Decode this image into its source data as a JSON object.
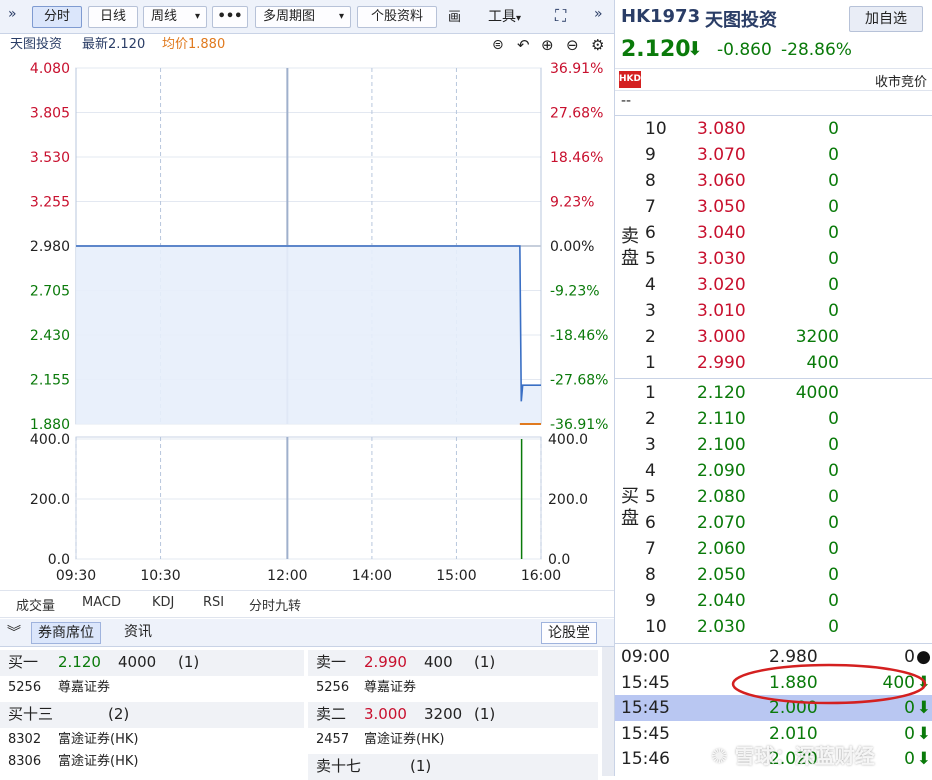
{
  "toolbar": {
    "expand_icon": "double-chevron-right-icon",
    "buttons": [
      "分时",
      "日线",
      "周线",
      "•••",
      "多周期图",
      "个股资料",
      "画",
      "工具"
    ],
    "fullscreen_icon": "fullscreen-icon",
    "collapse_icon": "double-chevron-right-icon"
  },
  "infobar": {
    "name": "天图投资",
    "latest": "最新2.120",
    "avg": "均价1.880"
  },
  "chart_data": {
    "type": "line",
    "price_ticks_left": [
      "4.080",
      "3.805",
      "3.530",
      "3.255",
      "2.980",
      "2.705",
      "2.430",
      "2.155",
      "1.880"
    ],
    "pct_ticks_right": [
      "36.91%",
      "27.68%",
      "18.46%",
      "9.23%",
      "0.00%",
      "-9.23%",
      "-18.46%",
      "-27.68%",
      "-36.91%"
    ],
    "ylim": [
      1.88,
      4.08
    ],
    "prev_close": 2.98,
    "time_labels": [
      "09:30",
      "10:30",
      "12:00",
      "14:00",
      "15:00",
      "16:00"
    ],
    "series": [
      {
        "values": [
          {
            "t": "09:30",
            "y": 2.98
          },
          {
            "t": "15:45",
            "y": 2.98
          },
          {
            "t": "15:46",
            "y": 2.02
          },
          {
            "t": "15:47",
            "y": 2.12
          },
          {
            "t": "16:00",
            "y": 2.12
          }
        ]
      },
      {
        "values": [
          {
            "t": "15:45",
            "y": 1.88
          },
          {
            "t": "16:00",
            "y": 1.88
          }
        ]
      }
    ],
    "volume_ticks_left": [
      "400.0",
      "200.0",
      "0.0"
    ],
    "volume_ticks_right": [
      "400.0",
      "200.0",
      "0.0"
    ],
    "volume_ylim": [
      0,
      400
    ],
    "volume_bars": [
      {
        "t": "15:45",
        "v": 400
      }
    ]
  },
  "indicator_tabs": [
    "成交量",
    "MACD",
    "KDJ",
    "RSI",
    "分时九转"
  ],
  "broker_header": {
    "collapse_icon": "double-chevron-down-icon",
    "tabs": [
      "券商席位",
      "资讯"
    ],
    "right_button": "论股堂"
  },
  "broker": {
    "bid": {
      "level1_label": "买一",
      "level1_price": "2.120",
      "level1_vol": "4000",
      "level1_count": "(1)",
      "level1_brokers": [
        {
          "id": "5256",
          "name": "尊嘉证券"
        }
      ],
      "level13_label": "买十三",
      "level13_count": "(2)",
      "level13_brokers": [
        {
          "id": "8302",
          "name": "富途证券(HK)"
        },
        {
          "id": "8306",
          "name": "富途证券(HK)"
        }
      ]
    },
    "ask": {
      "level1_label": "卖一",
      "level1_price": "2.990",
      "level1_vol": "400",
      "level1_count": "(1)",
      "level1_brokers": [
        {
          "id": "5256",
          "name": "尊嘉证券"
        }
      ],
      "level2_label": "卖二",
      "level2_price": "3.000",
      "level2_vol": "3200",
      "level2_count": "(1)",
      "level2_brokers": [
        {
          "id": "2457",
          "name": "富途证券(HK)"
        }
      ],
      "level17_label": "卖十七",
      "level17_count": "(1)"
    }
  },
  "quote": {
    "code": "HK1973",
    "name": "天图投资",
    "watch_button": "加自选",
    "price": "2.120",
    "change": "-0.860",
    "change_pct": "-28.86%",
    "market_badge": "HKD",
    "session_label": "收市竞价",
    "placeholder": "--"
  },
  "orderbook": {
    "ask_label": [
      "卖",
      "盘"
    ],
    "bid_label": [
      "买",
      "盘"
    ],
    "asks": [
      {
        "level": "10",
        "price": "3.080",
        "vol": "0"
      },
      {
        "level": "9",
        "price": "3.070",
        "vol": "0"
      },
      {
        "level": "8",
        "price": "3.060",
        "vol": "0"
      },
      {
        "level": "7",
        "price": "3.050",
        "vol": "0"
      },
      {
        "level": "6",
        "price": "3.040",
        "vol": "0"
      },
      {
        "level": "5",
        "price": "3.030",
        "vol": "0"
      },
      {
        "level": "4",
        "price": "3.020",
        "vol": "0"
      },
      {
        "level": "3",
        "price": "3.010",
        "vol": "0"
      },
      {
        "level": "2",
        "price": "3.000",
        "vol": "3200"
      },
      {
        "level": "1",
        "price": "2.990",
        "vol": "400"
      }
    ],
    "bids": [
      {
        "level": "1",
        "price": "2.120",
        "vol": "4000"
      },
      {
        "level": "2",
        "price": "2.110",
        "vol": "0"
      },
      {
        "level": "3",
        "price": "2.100",
        "vol": "0"
      },
      {
        "level": "4",
        "price": "2.090",
        "vol": "0"
      },
      {
        "level": "5",
        "price": "2.080",
        "vol": "0"
      },
      {
        "level": "6",
        "price": "2.070",
        "vol": "0"
      },
      {
        "level": "7",
        "price": "2.060",
        "vol": "0"
      },
      {
        "level": "8",
        "price": "2.050",
        "vol": "0"
      },
      {
        "level": "9",
        "price": "2.040",
        "vol": "0"
      },
      {
        "level": "10",
        "price": "2.030",
        "vol": "0"
      }
    ]
  },
  "ticks": [
    {
      "time": "09:00",
      "price": "2.980",
      "vol": "0",
      "icon": "neutral-dot-icon"
    },
    {
      "time": "15:45",
      "price": "1.880",
      "vol": "400",
      "icon": "down-arrow-icon"
    },
    {
      "time": "15:45",
      "price": "2.000",
      "vol": "0",
      "icon": "down-arrow-icon"
    },
    {
      "time": "15:45",
      "price": "2.010",
      "vol": "0",
      "icon": "down-arrow-icon"
    },
    {
      "time": "15:46",
      "price": "2.020",
      "vol": "0",
      "icon": "down-arrow-icon"
    }
  ],
  "watermark": "雪球：深蓝财经",
  "colors": {
    "up": "#c8102e",
    "down": "#0a7a0a",
    "line": "#3a6fc4",
    "avg": "#e07a1f",
    "highlight": "#b9c7f2",
    "annotation": "#d42020"
  }
}
